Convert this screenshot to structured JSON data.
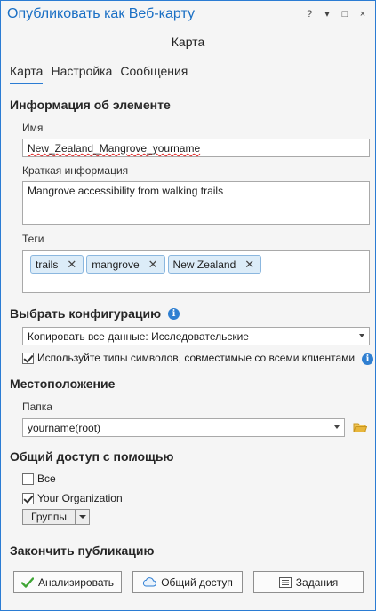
{
  "window": {
    "title": "Опубликовать как Веб-карту",
    "controls": [
      "?",
      "▾",
      "□",
      "×"
    ],
    "subtitle": "Карта"
  },
  "tabs": [
    {
      "label": "Карта",
      "active": true
    },
    {
      "label": "Настройка",
      "active": false
    },
    {
      "label": "Сообщения",
      "active": false
    }
  ],
  "item_info": {
    "heading": "Информация об элементе",
    "name_label": "Имя",
    "name_value": "New_Zealand_Mangrove_yourname",
    "summary_label": "Краткая информация",
    "summary_value": "Mangrove accessibility from walking trails",
    "tags_label": "Теги",
    "tags": [
      "trails",
      "mangrove",
      "New Zealand"
    ]
  },
  "configuration": {
    "heading": "Выбрать конфигурацию",
    "selected": "Копировать все данные: Исследовательские",
    "checkbox_label": "Используйте типы символов, совместимые со всеми клиентами",
    "checkbox_checked": true
  },
  "location": {
    "heading": "Местоположение",
    "folder_label": "Папка",
    "folder_value": "yourname(root)"
  },
  "sharing": {
    "heading": "Общий доступ с помощью",
    "everyone_label": "Все",
    "everyone_checked": false,
    "org_label": "Your Organization",
    "org_checked": true,
    "groups_label": "Группы"
  },
  "finish": {
    "heading": "Закончить публикацию",
    "analyze_label": "Анализировать",
    "share_label": "Общий доступ",
    "jobs_label": "Задания"
  },
  "colors": {
    "accent": "#2b7cd3",
    "tag_bg": "#dcecf8",
    "check_green": "#3fa535",
    "folder_yellow": "#e8b63a"
  }
}
